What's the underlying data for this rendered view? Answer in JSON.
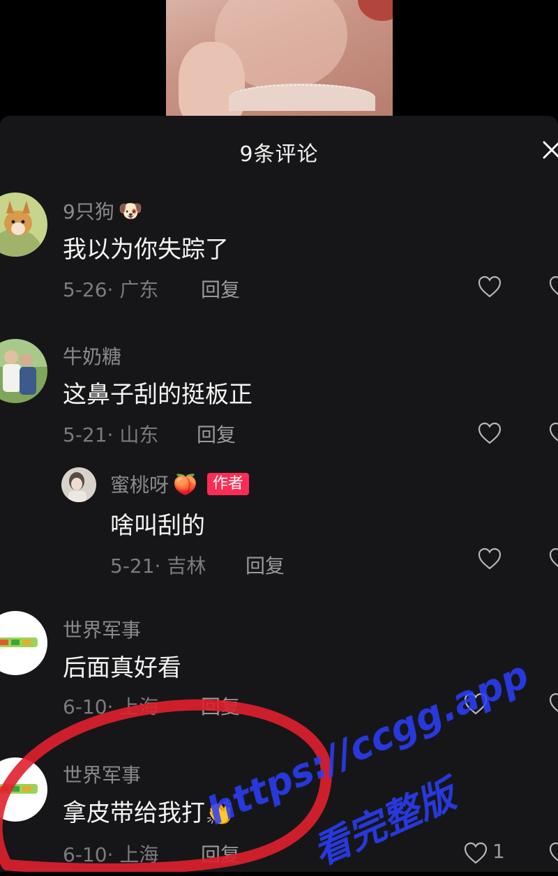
{
  "comments_panel": {
    "title": "9条评论"
  },
  "comments": [
    {
      "username": "9只狗",
      "username_emoji": "🐶",
      "text": "我以为你失踪了",
      "date_location": "5-26· 广东",
      "reply_label": "回复"
    },
    {
      "username": "牛奶糖",
      "text": "这鼻子刮的挺板正",
      "date_location": "5-21· 山东",
      "reply_label": "回复"
    },
    {
      "username": "蜜桃呀",
      "username_emoji": "🍑",
      "badge": "作者",
      "text": "啥叫刮的",
      "date_location": "5-21· 吉林",
      "reply_label": "回复"
    },
    {
      "username": "世界军事",
      "text": "后面真好看",
      "date_location": "6-10· 上海",
      "reply_label": "回复"
    },
    {
      "username": "世界军事",
      "text": "拿皮带给我打",
      "text_emoji": "👏",
      "date_location": "6-10· 上海",
      "reply_label": "回复",
      "like_count": "1"
    }
  ],
  "watermark": {
    "url": "https://ccgg.app",
    "tag": "看完整版"
  },
  "colors": {
    "panel_bg": "#161618",
    "author_badge": "#fe2c55",
    "annotation_circle": "#e0202e",
    "watermark": "#2a3fff"
  }
}
